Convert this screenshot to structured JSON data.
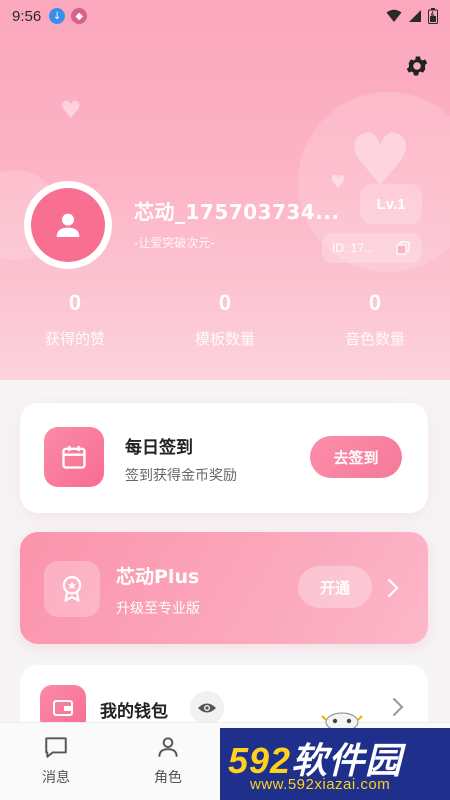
{
  "status_bar": {
    "time": "9:56",
    "icons": [
      "download-icon",
      "shield-icon",
      "wifi-icon",
      "signal-icon",
      "battery-icon"
    ]
  },
  "header": {
    "settings_icon": "gear-icon"
  },
  "profile": {
    "avatar_icon": "user-icon",
    "username": "芯动_175703734...",
    "motto": "-让爱突破次元-",
    "level": "Lv.1",
    "id_text": "ID: 17...",
    "copy_icon": "copy-icon"
  },
  "stats": [
    {
      "value": "0",
      "label": "获得的赞"
    },
    {
      "value": "0",
      "label": "模板数量"
    },
    {
      "value": "0",
      "label": "音色数量"
    }
  ],
  "daily_signin": {
    "title": "每日签到",
    "subtitle": "签到获得金币奖励",
    "button_label": "去签到"
  },
  "plus": {
    "title": "芯动Plus",
    "subtitle": "升级至专业版",
    "button_label": "开通"
  },
  "wallet": {
    "title": "我的钱包"
  },
  "bottom_nav": [
    {
      "label": "消息",
      "icon": "message-icon"
    },
    {
      "label": "角色",
      "icon": "person-icon"
    }
  ],
  "watermark": {
    "brand_number": "592",
    "brand_text": "软件园",
    "url": "www.592xiazai.com"
  },
  "colors": {
    "accent": "#f77899",
    "header_top": "#fba7bd",
    "watermark_bg": "#1e2f8c",
    "watermark_yellow": "#ffd21d"
  }
}
